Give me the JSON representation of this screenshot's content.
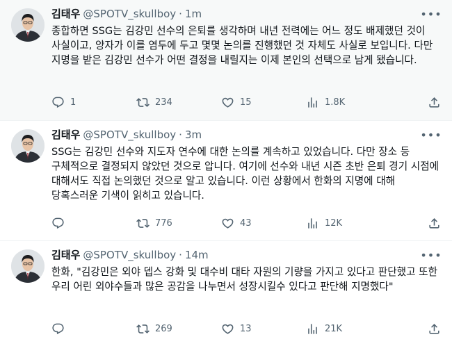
{
  "tweets": [
    {
      "name": "김태우",
      "handle": "@SPOTV_skullboy",
      "dot": "·",
      "time": "1m",
      "text": "종합하면 SSG는 김강민 선수의 은퇴를 생각하며 내년 전력에는 어느 정도 배제했던 것이 사실이고, 양자가 이를 염두에 두고 몇몇 논의를 진행했던 것 자체도 사실로 보입니다. 다만 지명을 받은 김강민 선수가 어떤 결정을 내릴지는 이제 본인의 선택으로 남게 됐습니다.",
      "replies": "1",
      "retweets": "234",
      "likes": "15",
      "views": "1.8K"
    },
    {
      "name": "김태우",
      "handle": "@SPOTV_skullboy",
      "dot": "·",
      "time": "3m",
      "text": "SSG는 김강민 선수와 지도자 연수에 대한 논의를 계속하고 있었습니다. 다만 장소 등 구체적으로 결정되지 않았던 것으로 압니다. 여기에 선수와 내년 시즌 초반 은퇴 경기 시점에 대해서도 직접 논의했던 것으로 알고 있습니다. 이런 상황에서 한화의 지명에 대해 당혹스러운 기색이 읽히고 있습니다.",
      "replies": "",
      "retweets": "776",
      "likes": "43",
      "views": "12K"
    },
    {
      "name": "김태우",
      "handle": "@SPOTV_skullboy",
      "dot": "·",
      "time": "14m",
      "text": "한화, \"김강민은 외야 뎁스 강화 및 대수비 대타 자원의 기량을 가지고 있다고 판단했고 또한 우리 어린 외야수들과 많은 공감을 나누면서 성장시킬수 있다고 판단해 지명했다\"",
      "replies": "",
      "retweets": "269",
      "likes": "13",
      "views": "21K"
    }
  ],
  "icons": {
    "more": "more-icon",
    "reply": "reply-icon",
    "retweet": "retweet-icon",
    "like": "like-icon",
    "views": "views-icon",
    "share": "share-icon"
  },
  "colors": {
    "text": "#0f1419",
    "secondary": "#536471",
    "highlight_bg": "#f7f9f9",
    "divider": "#eff3f4"
  }
}
